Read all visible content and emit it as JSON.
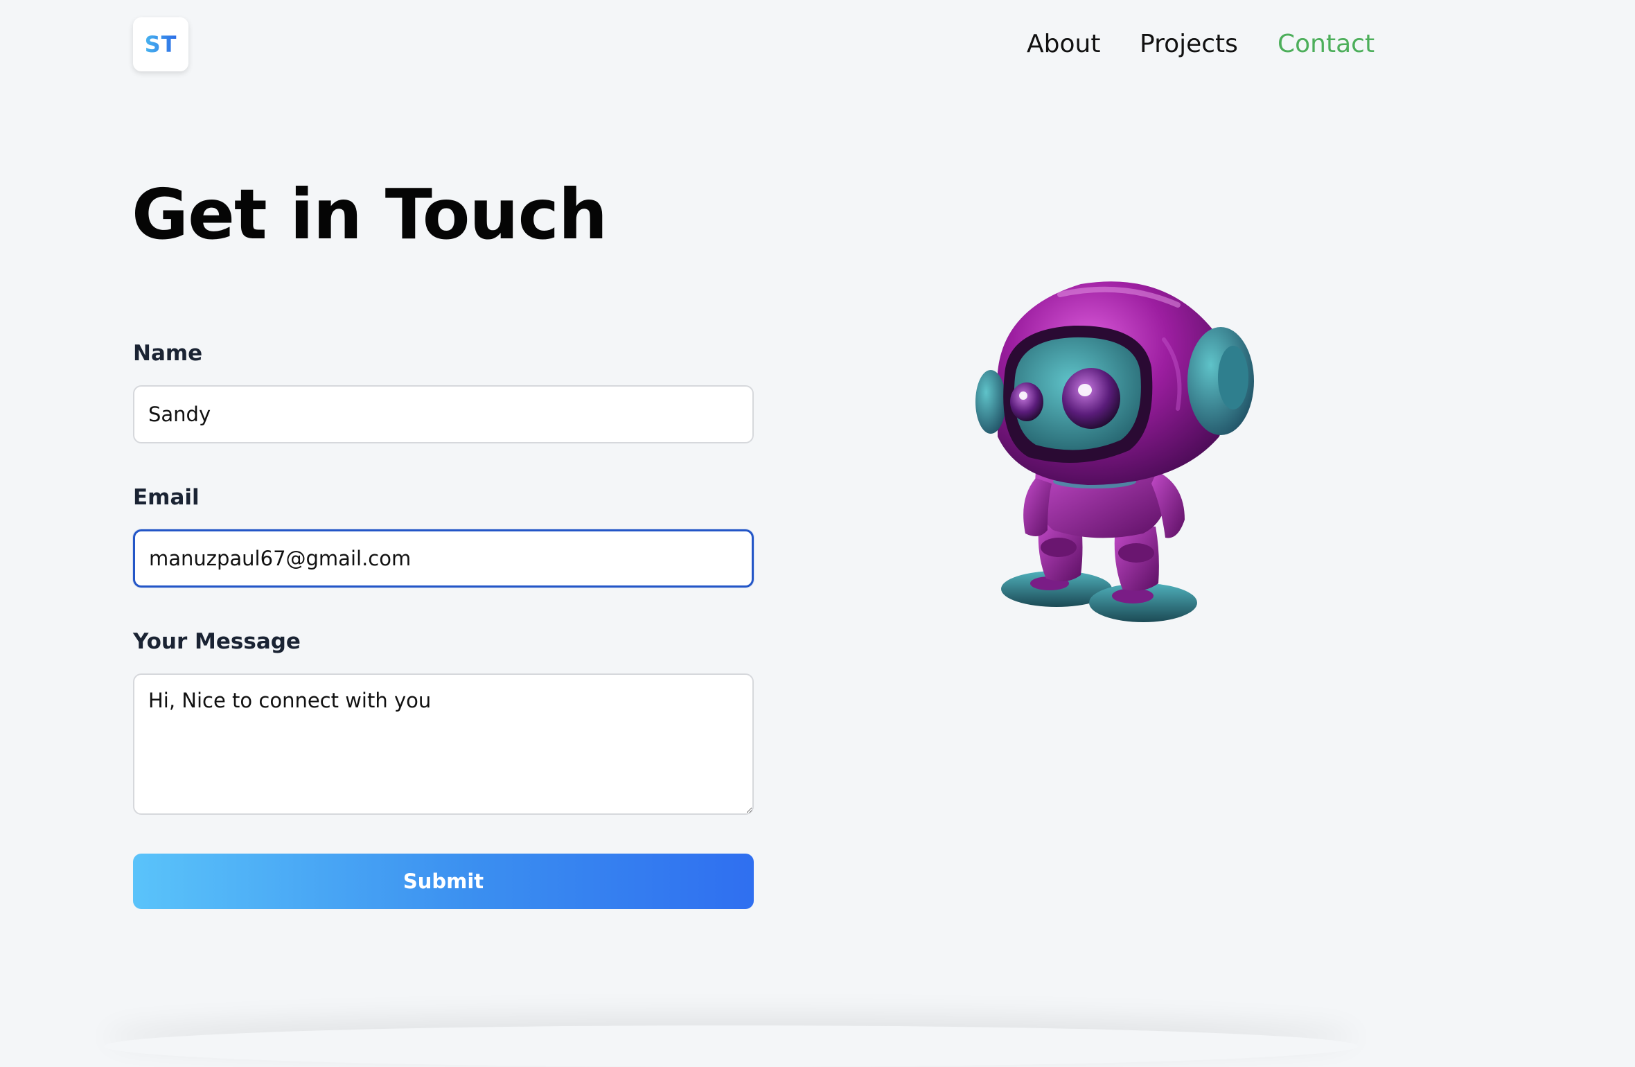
{
  "header": {
    "logo_text": "ST",
    "nav": [
      {
        "label": "About"
      },
      {
        "label": "Projects"
      },
      {
        "label": "Contact"
      }
    ],
    "active_color": "#4cae5a"
  },
  "main": {
    "title": "Get in Touch",
    "form": {
      "name_label": "Name",
      "name_value": "Sandy",
      "email_label": "Email",
      "email_value": "manuzpaul67@gmail.com",
      "message_label": "Your Message",
      "message_value": "Hi, Nice to connect with you",
      "submit_label": "Submit"
    },
    "illustration": {
      "icon": "robot-icon",
      "colors": {
        "helmet": "#9c1ea0",
        "face": "#3f9aa6"
      }
    }
  }
}
